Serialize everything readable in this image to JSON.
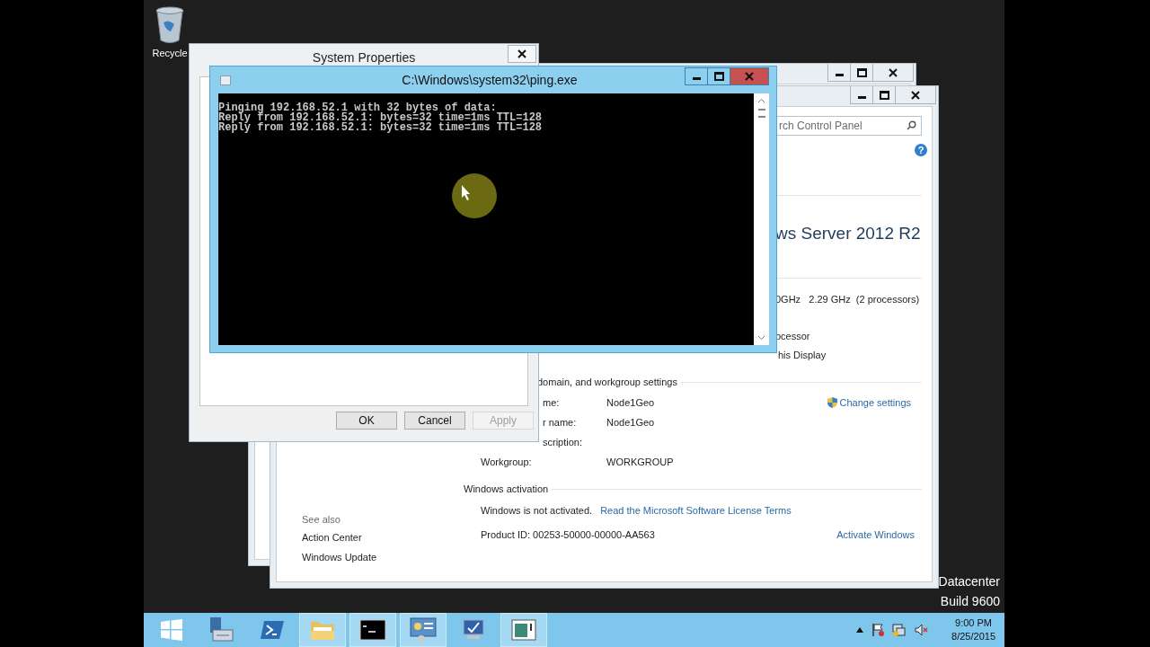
{
  "desktop": {
    "icons": [
      {
        "kind": "recycle-bin",
        "label": "Recycle"
      }
    ],
    "edition_lines": [
      "Datacenter",
      "Build 9600"
    ]
  },
  "system_window": {
    "search_placeholder": "rch Control Panel",
    "help": "?",
    "edition": "ws Server 2012 R2",
    "system_lines": [
      "0GHz   2.29 GHz  (2 processors)",
      "ocessor",
      "his Display"
    ],
    "computer_section": {
      "heading": "domain, and workgroup settings",
      "link": "Change settings",
      "rows": [
        {
          "label": "me:",
          "value": "Node1Geo"
        },
        {
          "label": "r name:",
          "value": "Node1Geo"
        },
        {
          "label": "scription:"
        },
        {
          "label": "Workgroup:",
          "value": "WORKGROUP"
        }
      ]
    },
    "activation": {
      "heading": "Windows activation",
      "status": "Windows is not activated.",
      "license_link": "Read the Microsoft Software License Terms",
      "product_id": "Product ID:  00253-50000-00000-AA563",
      "activate_link": "Activate Windows"
    },
    "see_also": {
      "heading": "See also",
      "links": [
        "Action Center",
        "Windows Update"
      ]
    }
  },
  "system_properties": {
    "title": "System Properties",
    "buttons": [
      {
        "label": "OK",
        "disabled": false
      },
      {
        "label": "Cancel",
        "disabled": false
      },
      {
        "label": "Apply",
        "disabled": true
      }
    ]
  },
  "console": {
    "title": "C:\\Windows\\system32\\ping.exe",
    "lines": [
      "Pinging 192.168.52.1 with 32 bytes of data:",
      "Reply from 192.168.52.1: bytes=32 time=1ms TTL=128",
      "Reply from 192.168.52.1: bytes=32 time=1ms TTL=128"
    ]
  },
  "taskbar": {
    "items": [
      {
        "kind": "start",
        "open": false
      },
      {
        "kind": "server-manager",
        "open": false
      },
      {
        "kind": "powershell",
        "open": false
      },
      {
        "kind": "explorer",
        "open": true
      },
      {
        "kind": "cmd",
        "open": true
      },
      {
        "kind": "control-panel",
        "open": true
      },
      {
        "kind": "system",
        "open": false
      },
      {
        "kind": "window",
        "open": true
      }
    ],
    "tray": [
      {
        "kind": "chevron"
      },
      {
        "kind": "flag"
      },
      {
        "kind": "network"
      },
      {
        "kind": "volume"
      }
    ],
    "clock": {
      "time": "9:00 PM",
      "date": "8/25/2015"
    }
  }
}
